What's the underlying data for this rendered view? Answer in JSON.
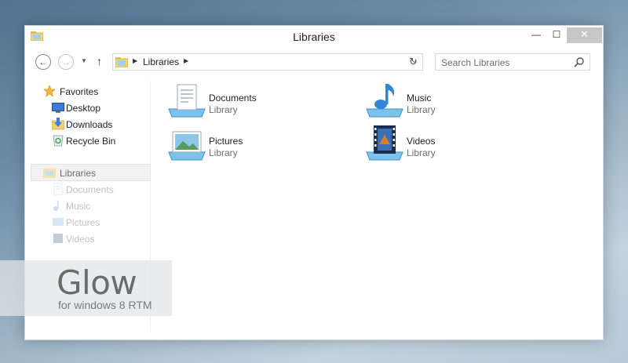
{
  "window": {
    "title": "Libraries",
    "controls": {
      "minimize": "—",
      "maximize": "☐",
      "close": "✕"
    }
  },
  "navigation": {
    "back": "←",
    "forward": "→",
    "recent": "▼",
    "up": "↑",
    "address": {
      "path_item": "Libraries",
      "separator": "▶",
      "dropdown": "⌄"
    },
    "refresh": "↻",
    "search": {
      "placeholder": "Search Libraries"
    }
  },
  "nav_pane": {
    "favorites": {
      "label": "Favorites",
      "items": [
        {
          "label": "Desktop",
          "icon": "desktop-icon"
        },
        {
          "label": "Downloads",
          "icon": "downloads-icon"
        },
        {
          "label": "Recycle Bin",
          "icon": "recycle-bin-icon"
        }
      ]
    },
    "libraries": {
      "label": "Libraries",
      "items": [
        {
          "label": "Documents",
          "icon": "documents-icon"
        },
        {
          "label": "Music",
          "icon": "music-icon"
        },
        {
          "label": "Pictures",
          "icon": "pictures-icon"
        },
        {
          "label": "Videos",
          "icon": "videos-icon"
        }
      ]
    }
  },
  "content": {
    "libraries": [
      {
        "name": "Documents",
        "type": "Library",
        "icon": "documents-library-icon"
      },
      {
        "name": "Music",
        "type": "Library",
        "icon": "music-library-icon"
      },
      {
        "name": "Pictures",
        "type": "Library",
        "icon": "pictures-library-icon"
      },
      {
        "name": "Videos",
        "type": "Library",
        "icon": "videos-library-icon"
      }
    ]
  },
  "watermark": {
    "title": "Glow",
    "subtitle": "for windows 8 RTM"
  },
  "colors": {
    "accent": "#3f8fd0",
    "close_button": "#c7c7c7",
    "selection": "#f2f2f2"
  }
}
